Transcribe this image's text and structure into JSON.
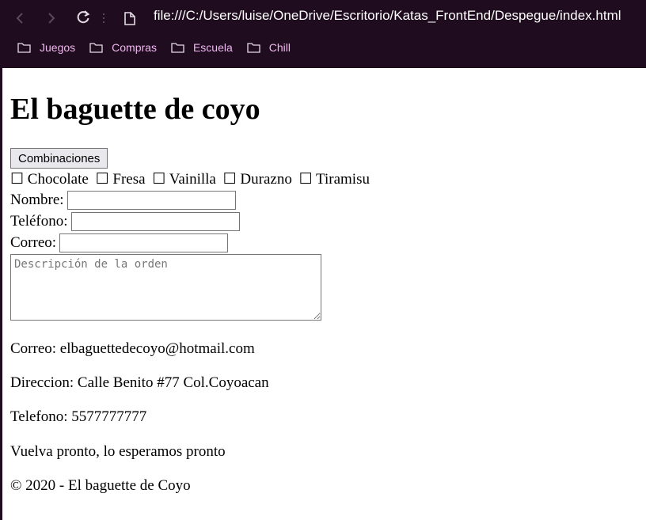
{
  "browser": {
    "url": "file:///C:/Users/luise/OneDrive/Escritorio/Katas_FrontEnd/Despegue/index.html",
    "bookmarks": [
      "Juegos",
      "Compras",
      "Escuela",
      "Chill"
    ]
  },
  "page": {
    "title": "El baguette de coyo",
    "button_label": "Combinaciones",
    "flavors": [
      "Chocolate",
      "Fresa",
      "Vainilla",
      "Durazno",
      "Tiramisu"
    ],
    "checkbox_glyph": "☐",
    "form": {
      "name_label": "Nombre:",
      "phone_label": "Teléfono:",
      "email_label": "Correo:",
      "description_placeholder": "Descripción de la orden"
    },
    "info": {
      "email": "Correo: elbaguettedecoyo@hotmail.com",
      "address": "Direccion: Calle Benito #77 Col.Coyoacan",
      "phone": "Telefono: 5577777777",
      "farewell": "Vuelva pronto, lo esperamos pronto",
      "copyright": "© 2020 - El baguette de Coyo"
    }
  }
}
